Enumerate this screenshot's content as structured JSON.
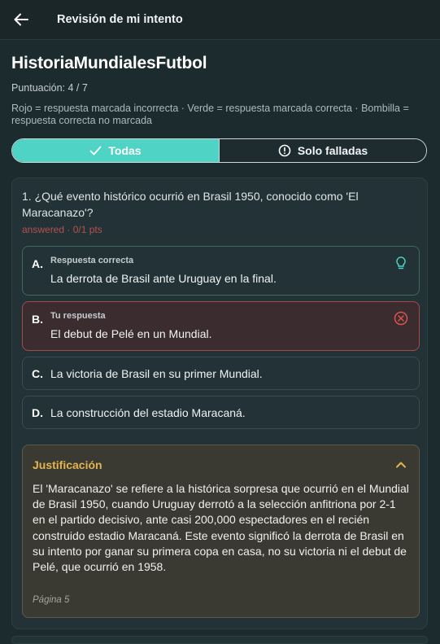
{
  "header": {
    "title": "Revisión de mi intento",
    "back_icon": "arrow-left-icon"
  },
  "quiz": {
    "title": "HistoriaMundialesFutbol",
    "score": "Puntuación: 4 / 7",
    "legend": "Rojo = respuesta marcada incorrecta · Verde = respuesta marcada correcta · Bombilla = respuesta correcta no marcada"
  },
  "filter": {
    "all_label": "Todas",
    "failed_label": "Solo falladas",
    "active": "all"
  },
  "question": {
    "text": "1. ¿Qué evento histórico ocurrió en Brasil 1950, conocido como 'El Maracanazo'?",
    "meta": "answered · 0/1 pts",
    "options": [
      {
        "letter": "A.",
        "tag": "Respuesta correcta",
        "text": "La derrota de Brasil ante Uruguay en la final.",
        "icon": "lightbulb-icon"
      },
      {
        "letter": "B.",
        "tag": "Tu respuesta",
        "text": "El debut de Pelé en un Mundial.",
        "icon": "x-circle-icon"
      },
      {
        "letter": "C.",
        "tag": "",
        "text": "La victoria de Brasil en su primer Mundial."
      },
      {
        "letter": "D.",
        "tag": "",
        "text": "La construcción del estadio Maracaná."
      }
    ]
  },
  "justification": {
    "title": "Justificación",
    "text": "El 'Maracanazo' se refiere a la histórica sorpresa que ocurrió en el Mundial de Brasil 1950, cuando Uruguay derrotó a la selección anfitriona por 2-1 en el partido decisivo, ante casi 200,000 espectadores en el recién construido estadio Maracaná. Este evento significó la derrota de Brasil en su intento por ganar su primera copa en casa, no su victoria ni el debut de Pelé, que ocurrió en 1958.",
    "page": "Página 5"
  },
  "colors": {
    "accent": "#4fd3c4",
    "correct_border": "#3f6a5e",
    "incorrect_border": "#a64a48",
    "justification_title": "#e2b550",
    "meta_red": "#b5524d"
  }
}
